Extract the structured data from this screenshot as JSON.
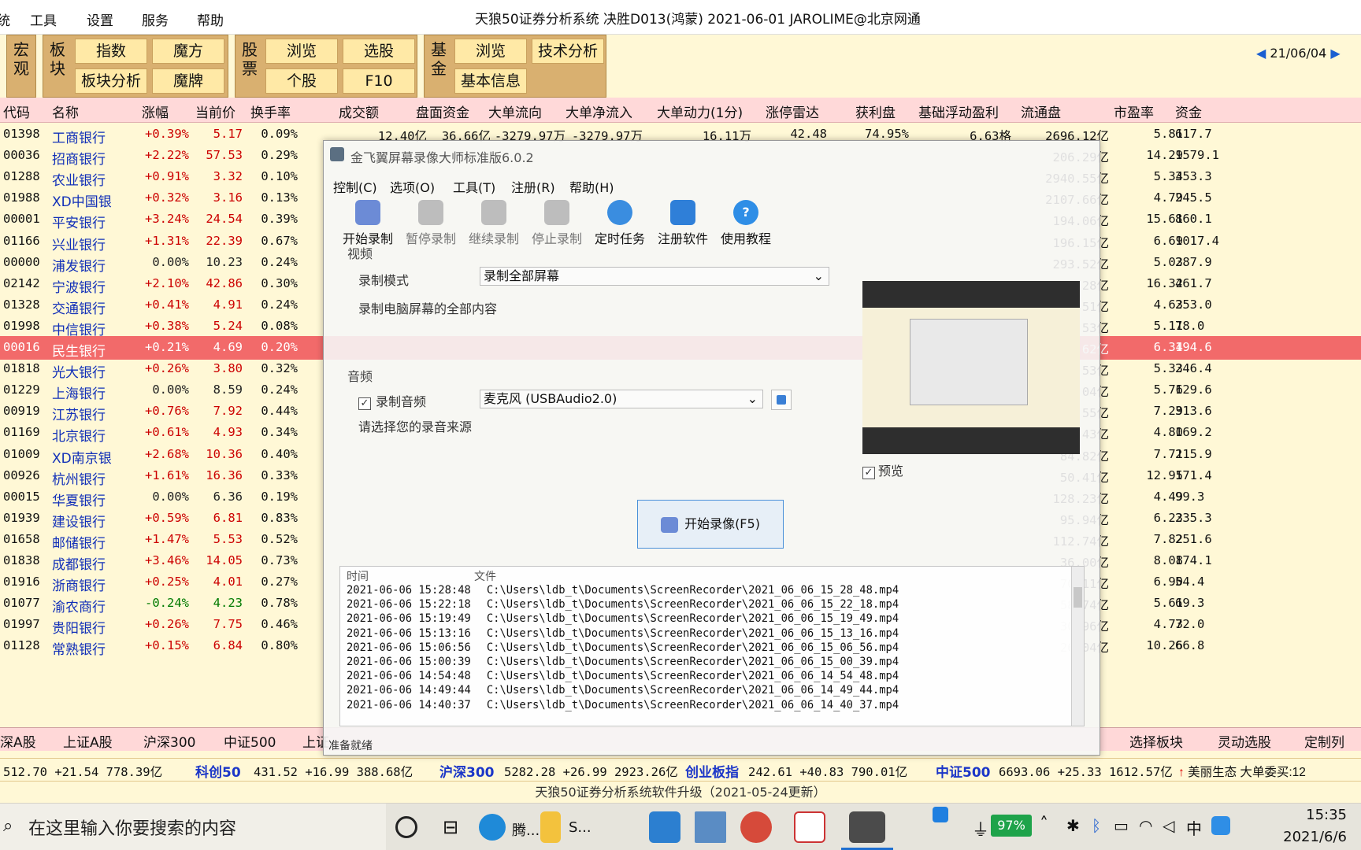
{
  "menubar": {
    "items": [
      "统",
      "工具",
      "设置",
      "服务",
      "帮助"
    ],
    "title": "天狼50证券分析系统  决胜D013(鸿蒙)  2021-06-01 JAROLIME@北京网通"
  },
  "toolbar": {
    "groups": [
      {
        "label": "宏观",
        "buttons": []
      },
      {
        "label": "板块",
        "buttons": [
          "指数",
          "魔方",
          "板块分析",
          "魔牌"
        ]
      },
      {
        "label": "股票",
        "buttons": [
          "浏览",
          "选股",
          "个股",
          "F10"
        ]
      },
      {
        "label": "基金",
        "buttons": [
          "浏览",
          "技术分析",
          "基本信息"
        ]
      }
    ],
    "date": "21/06/04"
  },
  "grid": {
    "headers": [
      "代码",
      "名称",
      "涨幅",
      "当前价",
      "换手率",
      "成交额",
      "盘面资金",
      "大单流向",
      "大单净流入",
      "大单动力(1分)",
      "涨停雷达",
      "获利盘",
      "基础浮动盈利",
      "流通盘",
      "市盈率",
      "资金"
    ],
    "rows": [
      [
        "01398",
        "工商银行",
        "+0.39%",
        "5.17",
        "0.09%",
        "12.40亿",
        "36.66亿",
        "-3279.97万",
        "-3279.97万",
        "16.11万",
        "42.48",
        "74.95%",
        "6.63格",
        "2696.12亿",
        "5.81",
        "617.7"
      ],
      [
        "00036",
        "招商银行",
        "+2.22%",
        "57.53",
        "0.29%",
        "",
        "",
        "",
        "",
        "",
        "",
        "",
        "",
        "206.29亿",
        "14.29",
        "1579.1"
      ],
      [
        "01288",
        "农业银行",
        "+0.91%",
        "3.32",
        "0.10%",
        "",
        "",
        "",
        "",
        "",
        "",
        "",
        "",
        "2940.55亿",
        "5.34",
        "353.3"
      ],
      [
        "01988",
        "XD中国银",
        "+0.32%",
        "3.16",
        "0.13%",
        "",
        "",
        "",
        "",
        "",
        "",
        "",
        "",
        "2107.66亿",
        "4.79",
        "245.5"
      ],
      [
        "00001",
        "平安银行",
        "+3.24%",
        "24.54",
        "0.39%",
        "",
        "",
        "",
        "",
        "",
        "",
        "",
        "",
        "194.06亿",
        "15.61",
        "860.1"
      ],
      [
        "01166",
        "兴业银行",
        "+1.31%",
        "22.39",
        "0.67%",
        "",
        "",
        "",
        "",
        "",
        "",
        "",
        "",
        "196.15亿",
        "6.69",
        "1017.4"
      ],
      [
        "00000",
        "浦发银行",
        "0.00%",
        "10.23",
        "0.24%",
        "",
        "",
        "",
        "",
        "",
        "",
        "",
        "",
        "293.52亿",
        "5.03",
        "287.9"
      ],
      [
        "02142",
        "宁波银行",
        "+2.10%",
        "42.86",
        "0.30%",
        "",
        "",
        "",
        "",
        "",
        "",
        "",
        "",
        "59.28亿",
        "16.32",
        "461.7"
      ],
      [
        "01328",
        "交通银行",
        "+0.41%",
        "4.91",
        "0.24%",
        "",
        "",
        "",
        "",
        "",
        "",
        "",
        "",
        "392.51亿",
        "4.63",
        "253.0"
      ],
      [
        "01998",
        "中信银行",
        "+0.38%",
        "5.24",
        "0.08%",
        "",
        "",
        "",
        "",
        "",
        "",
        "",
        "",
        "340.53亿",
        "5.11",
        "78.0"
      ],
      [
        "00016",
        "民生银行",
        "+0.21%",
        "4.69",
        "0.20%",
        "",
        "",
        "",
        "",
        "",
        "",
        "",
        "",
        "354.62亿",
        "6.34",
        "194.6"
      ],
      [
        "01818",
        "光大银行",
        "+0.26%",
        "3.80",
        "0.32%",
        "",
        "",
        "",
        "",
        "",
        "",
        "",
        "",
        "413.53亿",
        "5.33",
        "246.4"
      ],
      [
        "01229",
        "上海银行",
        "0.00%",
        "8.59",
        "0.24%",
        "",
        "",
        "",
        "",
        "",
        "",
        "",
        "",
        "137.04亿",
        "5.76",
        "129.6"
      ],
      [
        "00919",
        "江苏银行",
        "+0.76%",
        "7.92",
        "0.44%",
        "",
        "",
        "",
        "",
        "",
        "",
        "",
        "",
        "146.55亿",
        "7.29",
        "313.6"
      ],
      [
        "01169",
        "北京银行",
        "+0.61%",
        "4.93",
        "0.34%",
        "",
        "",
        "",
        "",
        "",
        "",
        "",
        "",
        "211.43亿",
        "4.80",
        "169.2"
      ],
      [
        "01009",
        "XD南京银",
        "+2.68%",
        "10.36",
        "0.40%",
        "",
        "",
        "",
        "",
        "",
        "",
        "",
        "",
        "84.82亿",
        "7.71",
        "215.9"
      ],
      [
        "00926",
        "杭州银行",
        "+1.61%",
        "16.36",
        "0.33%",
        "",
        "",
        "",
        "",
        "",
        "",
        "",
        "",
        "50.41亿",
        "12.95",
        "171.4"
      ],
      [
        "00015",
        "华夏银行",
        "0.00%",
        "6.36",
        "0.19%",
        "",
        "",
        "",
        "",
        "",
        "",
        "",
        "",
        "128.23亿",
        "4.49",
        "99.3"
      ],
      [
        "01939",
        "建设银行",
        "+0.59%",
        "6.81",
        "0.83%",
        "",
        "",
        "",
        "",
        "",
        "",
        "",
        "",
        "95.94亿",
        "6.23",
        "235.3"
      ],
      [
        "01658",
        "邮储银行",
        "+1.47%",
        "5.53",
        "0.52%",
        "",
        "",
        "",
        "",
        "",
        "",
        "",
        "",
        "112.74亿",
        "7.82",
        "251.6"
      ],
      [
        "01838",
        "成都银行",
        "+3.46%",
        "14.05",
        "0.73%",
        "",
        "",
        "",
        "",
        "",
        "",
        "",
        "",
        "36.00亿",
        "8.08",
        "174.1"
      ],
      [
        "01916",
        "浙商银行",
        "+0.25%",
        "4.01",
        "0.27%",
        "",
        "",
        "",
        "",
        "",
        "",
        "",
        "",
        "70.11亿",
        "6.90",
        "54.4"
      ],
      [
        "01077",
        "渝农商行",
        "-0.24%",
        "4.23",
        "0.78%",
        "",
        "",
        "",
        "",
        "",
        "",
        "",
        "",
        "58.74亿",
        "5.61",
        "69.3"
      ],
      [
        "01997",
        "贵阳银行",
        "+0.26%",
        "7.75",
        "0.46%",
        "",
        "",
        "",
        "",
        "",
        "",
        "",
        "",
        "30.96亿",
        "4.73",
        "72.0"
      ],
      [
        "01128",
        "常熟银行",
        "+0.15%",
        "6.84",
        "0.80%",
        "",
        "",
        "",
        "",
        "",
        "",
        "",
        "",
        "26.04亿",
        "10.26",
        "66.8"
      ]
    ]
  },
  "tabs": [
    "深A股",
    "上证A股",
    "沪深300",
    "中证500",
    "上证",
    "选择板块",
    "灵动选股",
    "定制列"
  ],
  "quotebar": [
    {
      "pre": "512.70  +21.54  778.39亿",
      "idx": "科创50"
    },
    {
      "pre": "431.52  +16.99  388.68亿",
      "idx": "沪深300"
    },
    {
      "pre": "5282.28  +26.99  2923.26亿",
      "idx": "创业板指"
    },
    {
      "pre": "242.61  +40.83  790.01亿",
      "idx": "中证500"
    },
    {
      "pre": "6693.06  +25.33  1612.57亿",
      "idx": ""
    }
  ],
  "quote_tail": "美丽生态  大单委买:12",
  "notice": "天狼50证券分析系统软件升级（2021-05-24更新）",
  "dialog": {
    "title": "金飞翼屏幕录像大师标准版6.0.2",
    "menu": [
      "控制(C)",
      "选项(O)",
      "工具(T)",
      "注册(R)",
      "帮助(H)"
    ],
    "tools": [
      "开始录制",
      "暂停录制",
      "继续录制",
      "停止录制",
      "定时任务",
      "注册软件",
      "使用教程"
    ],
    "video_label": "视频",
    "mode_label": "录制模式",
    "mode_value": "录制全部屏幕",
    "mode_desc": "录制电脑屏幕的全部内容",
    "audio_label": "音频",
    "audio_checkbox": "录制音频",
    "audio_device": "麦克风 (USBAudio2.0)",
    "audio_hint": "请选择您的录音来源",
    "preview_label": "预览",
    "start_button": "开始录像(F5)",
    "log_headers": [
      "时间",
      "文件"
    ],
    "log_rows": [
      [
        "2021-06-06 15:28:48",
        "C:\\Users\\ldb_t\\Documents\\ScreenRecorder\\2021_06_06_15_28_48.mp4"
      ],
      [
        "2021-06-06 15:22:18",
        "C:\\Users\\ldb_t\\Documents\\ScreenRecorder\\2021_06_06_15_22_18.mp4"
      ],
      [
        "2021-06-06 15:19:49",
        "C:\\Users\\ldb_t\\Documents\\ScreenRecorder\\2021_06_06_15_19_49.mp4"
      ],
      [
        "2021-06-06 15:13:16",
        "C:\\Users\\ldb_t\\Documents\\ScreenRecorder\\2021_06_06_15_13_16.mp4"
      ],
      [
        "2021-06-06 15:06:56",
        "C:\\Users\\ldb_t\\Documents\\ScreenRecorder\\2021_06_06_15_06_56.mp4"
      ],
      [
        "2021-06-06 15:00:39",
        "C:\\Users\\ldb_t\\Documents\\ScreenRecorder\\2021_06_06_15_00_39.mp4"
      ],
      [
        "2021-06-06 14:54:48",
        "C:\\Users\\ldb_t\\Documents\\ScreenRecorder\\2021_06_06_14_54_48.mp4"
      ],
      [
        "2021-06-06 14:49:44",
        "C:\\Users\\ldb_t\\Documents\\ScreenRecorder\\2021_06_06_14_49_44.mp4"
      ],
      [
        "2021-06-06 14:40:37",
        "C:\\Users\\ldb_t\\Documents\\ScreenRecorder\\2021_06_06_14_40_37.mp4"
      ]
    ],
    "status": "准备就绪"
  },
  "taskbar": {
    "search_placeholder": "在这里输入你要搜索的内容",
    "apps": [
      "腾...",
      "S..."
    ],
    "battery": "97%",
    "ime": "中",
    "time": "15:35",
    "date": "2021/6/6"
  },
  "colors": {
    "up": "#cc0000",
    "down": "#007a00",
    "flat": "#222222",
    "selected_row": "#f26a6a",
    "header": "#ffd9d9",
    "toolbar": "#d9b070"
  }
}
